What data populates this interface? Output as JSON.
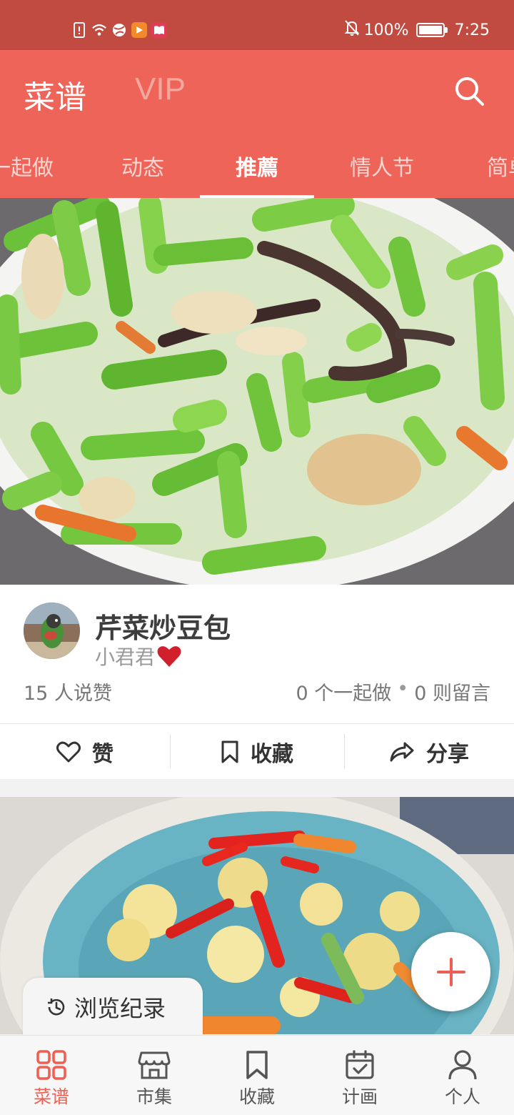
{
  "status_bar": {
    "battery": "100%",
    "time": "7:25",
    "battery_level": 1.0
  },
  "header": {
    "title": "菜谱",
    "vip_label": "VIP"
  },
  "tabs": [
    {
      "label": "一起做",
      "active": false
    },
    {
      "label": "动态",
      "active": false
    },
    {
      "label": "推薦",
      "active": true
    },
    {
      "label": "情人节",
      "active": false
    },
    {
      "label": "简单",
      "active": false
    }
  ],
  "feed": [
    {
      "title": "芹菜炒豆包",
      "author": "小君君",
      "likes": "15 人说赞",
      "cooked": "0 个一起做",
      "separator": "•",
      "comments": "0 则留言",
      "actions": {
        "like": "赞",
        "favorite": "收藏",
        "share": "分享"
      }
    }
  ],
  "history_label": "浏览纪录",
  "bottom_nav": [
    {
      "label": "菜谱",
      "active": true
    },
    {
      "label": "市集",
      "active": false
    },
    {
      "label": "收藏",
      "active": false
    },
    {
      "label": "计画",
      "active": false
    },
    {
      "label": "个人",
      "active": false
    }
  ],
  "colors": {
    "brand": "#ee6458",
    "status_bar": "#c14b41",
    "accent": "#ee5e52"
  }
}
